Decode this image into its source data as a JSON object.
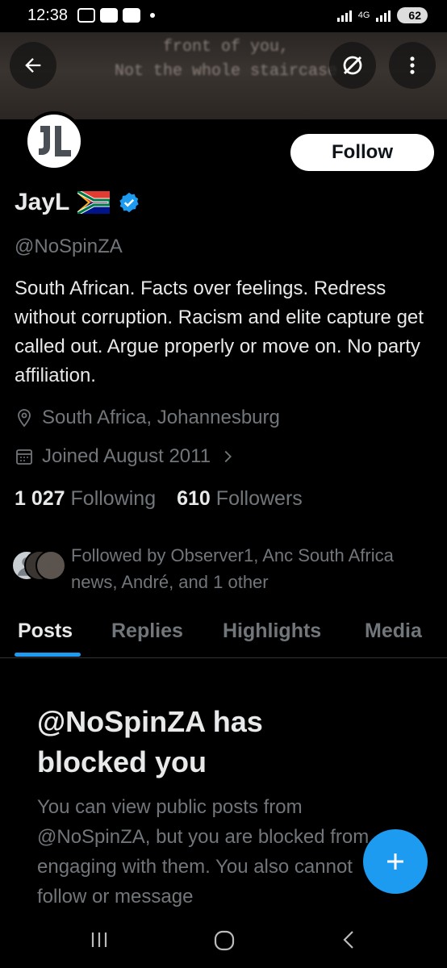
{
  "status_bar": {
    "time": "12:38",
    "network": "4G",
    "battery": "62"
  },
  "banner": {
    "text": "front of you,\nNot the whole staircase"
  },
  "header": {
    "back_icon": "arrow-left-icon",
    "grok_icon": "grok-icon",
    "more_icon": "more-vertical-icon"
  },
  "profile": {
    "avatar_icon": "jl-logo",
    "follow_label": "Follow",
    "display_name": "JayL",
    "flag": "south-africa-flag",
    "verified_icon": "verified-badge-icon",
    "handle": "@NoSpinZA",
    "bio": "South African. Facts over feelings. Redress without corruption. Racism and elite capture get called out. Argue properly or move on. No party affiliation.",
    "location": "South Africa, Johannesburg",
    "joined": "Joined August 2011",
    "following_count": "1 027",
    "following_label": "Following",
    "followers_count": "610",
    "followers_label": "Followers",
    "followed_by": "Followed by Observer1, Anc South Africa news, André, and 1 other"
  },
  "tabs": [
    {
      "label": "Posts",
      "active": true
    },
    {
      "label": "Replies",
      "active": false
    },
    {
      "label": "Highlights",
      "active": false
    },
    {
      "label": "Media",
      "active": false
    }
  ],
  "blocked": {
    "title": "@NoSpinZA has blocked you",
    "body": "You can view public posts from @NoSpinZA, but you are blocked from engaging with them. You also cannot follow or message"
  },
  "fab": {
    "icon": "plus-icon"
  },
  "nav": {
    "recent_icon": "recents-icon",
    "home_icon": "home-icon",
    "back_icon": "back-icon"
  },
  "colors": {
    "accent": "#1d9bf0",
    "background": "#000000",
    "text": "#e7e9ea",
    "muted": "#71767b"
  }
}
